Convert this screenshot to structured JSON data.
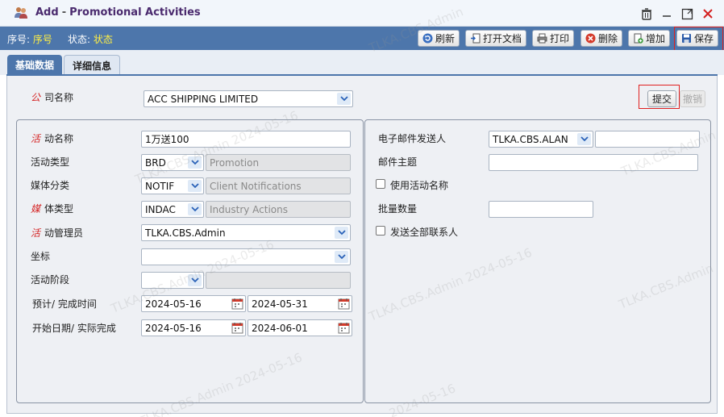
{
  "window": {
    "title_action": "Add",
    "title_separator": "-",
    "title_name": "Promotional Activities"
  },
  "toolbar": {
    "seq_label": "序号:",
    "seq_value": "序号",
    "status_label": "状态:",
    "status_value": "状态",
    "buttons": {
      "refresh": "刷新",
      "open_doc": "打开文档",
      "print": "打印",
      "delete": "删除",
      "add": "增加",
      "save": "保存"
    }
  },
  "tabs": {
    "basic": "基础数据",
    "detail": "详细信息"
  },
  "company": {
    "label_req": "公",
    "label_rest": "司名称",
    "value": "ACC SHIPPING LIMITED"
  },
  "actions": {
    "submit": "提交",
    "revoke": "撤销"
  },
  "left_form": {
    "activity_name": {
      "label_req": "活",
      "label_rest": "动名称",
      "value": "1万送100"
    },
    "activity_type": {
      "label": "活动类型",
      "code": "BRD",
      "desc": "Promotion"
    },
    "media_category": {
      "label": "媒体分类",
      "code": "NOTIF",
      "desc": "Client Notifications"
    },
    "media_type": {
      "label_req": "媒",
      "label_rest": "体类型",
      "code": "INDAC",
      "desc": "Industry Actions"
    },
    "activity_manager": {
      "label_req": "活",
      "label_rest": "动管理员",
      "value": "TLKA.CBS.Admin"
    },
    "coordinate": {
      "label": "坐标",
      "value": ""
    },
    "activity_stage": {
      "label": "活动阶段",
      "code": "",
      "desc": ""
    },
    "planned_completion": {
      "label": "预计/ 完成时间",
      "start": "2024-05-16",
      "end": "2024-05-31"
    },
    "actual_dates": {
      "label": "开始日期/ 实际完成",
      "start": "2024-05-16",
      "end": "2024-06-01"
    }
  },
  "right_form": {
    "email_sender": {
      "label": "电子邮件发送人",
      "value": "TLKA.CBS.ALAN",
      "extra": ""
    },
    "email_subject": {
      "label": "邮件主题",
      "value": ""
    },
    "use_activity_name": {
      "label": "使用活动名称",
      "checked": false
    },
    "batch_quantity": {
      "label": "批量数量",
      "value": ""
    },
    "send_all_contacts": {
      "label": "发送全部联系人",
      "checked": false
    }
  },
  "watermark": {
    "user": "TLKA.CBS.Admin",
    "date": "2024-05-16",
    "full": "TLKA.CBS.Admin 2024-05-16"
  }
}
